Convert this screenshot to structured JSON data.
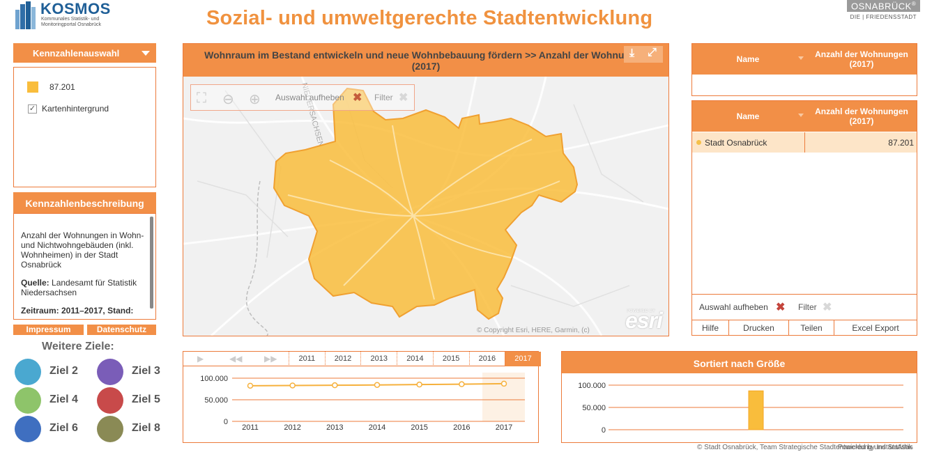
{
  "header": {
    "brand": "KOSMOS",
    "brand_sub": "Kommunales Statistik- und Monitoringportal Osnabrück",
    "title": "Sozial- und umweltgerechte Stadtentwicklung",
    "city": "OSNABRÜCK",
    "city_reg": "®",
    "motto": "DIE | FRIEDENSSTADT"
  },
  "indicator_select": {
    "label": "Kennzahlenauswahl"
  },
  "legend": {
    "value": "87.201",
    "swatch_color": "#f9bd3c",
    "basemap_checkbox": "Kartenhintergrund",
    "basemap_checked": true
  },
  "description": {
    "title": "Kennzahlenbeschreibung",
    "text": "Anzahl der Wohnungen in Wohn- und Nichtwohngebäuden (inkl. Wohnheimen) in der Stadt Osnabrück",
    "source_label": "Quelle:",
    "source_text": "Landesamt für Statistik Niedersachsen",
    "period_partial": "Zeitraum: 2011–2017, Stand:"
  },
  "links": {
    "impressum": "Impressum",
    "datenschutz": "Datenschutz"
  },
  "more_goals": {
    "title": "Weitere Ziele:",
    "items": [
      {
        "label": "Ziel 2",
        "color": "#4aa8d0"
      },
      {
        "label": "Ziel 3",
        "color": "#7a5db8"
      },
      {
        "label": "Ziel 4",
        "color": "#8ec46a"
      },
      {
        "label": "Ziel 5",
        "color": "#c84a4a"
      },
      {
        "label": "Ziel 6",
        "color": "#3f6fc0"
      },
      {
        "label": "Ziel 8",
        "color": "#8a8a55"
      }
    ]
  },
  "map": {
    "title_line1": "Wohnraum im Bestand entwickeln und neue Wohnbebauung fördern >>  Anzahl der Wohnungen",
    "title_line2": "(2017)",
    "toolbar": {
      "reset_label": "Auswahl aufheben",
      "filter_label": "Filter"
    },
    "copyright": "© Copyright Esri, HERE, Garmin, (c)",
    "esri_powered": "POWERED BY",
    "esri": "esri",
    "fill_color": "#f9bd3c",
    "street_label": "NIEDERSACHSEN"
  },
  "table_selection": {
    "col_name": "Name",
    "col_value": "Anzahl der Wohnungen (2017)"
  },
  "table_main": {
    "col_name": "Name",
    "col_value": "Anzahl der Wohnungen (2017)",
    "rows": [
      {
        "name": "Stadt Osnabrück",
        "value": "87.201"
      }
    ],
    "reset_label": "Auswahl aufheben",
    "filter_label": "Filter",
    "buttons": [
      "Hilfe",
      "Drucken",
      "Teilen",
      "Excel Export"
    ]
  },
  "timeline": {
    "years": [
      "2011",
      "2012",
      "2013",
      "2014",
      "2015",
      "2016",
      "2017"
    ],
    "selected_year": "2017",
    "y_ticks": [
      "100.000",
      "50.000",
      "0"
    ]
  },
  "ranking": {
    "title": "Sortiert nach Größe",
    "y_ticks": [
      "100.000",
      "50.000",
      "0"
    ]
  },
  "chart_data": [
    {
      "type": "line",
      "x": [
        2011,
        2012,
        2013,
        2014,
        2015,
        2016,
        2017
      ],
      "series": [
        {
          "values": [
            82500,
            83100,
            83600,
            84300,
            85200,
            86000,
            87201
          ]
        }
      ],
      "ylim": [
        0,
        100000
      ],
      "yticks": [
        0,
        50000,
        100000
      ],
      "color": "#f6b13d"
    },
    {
      "type": "bar",
      "title": "Sortiert nach Größe",
      "categories": [
        "Stadt Osnabrück"
      ],
      "values": [
        87201
      ],
      "ylim": [
        0,
        100000
      ],
      "yticks": [
        0,
        50000,
        100000
      ],
      "color": "#f9bd3c"
    }
  ],
  "footer": {
    "copyright": "© Stadt Osnabrück, Team Strategische Stadtentwicklung und Statistik",
    "powered": "Powered by InstantAtlas"
  }
}
